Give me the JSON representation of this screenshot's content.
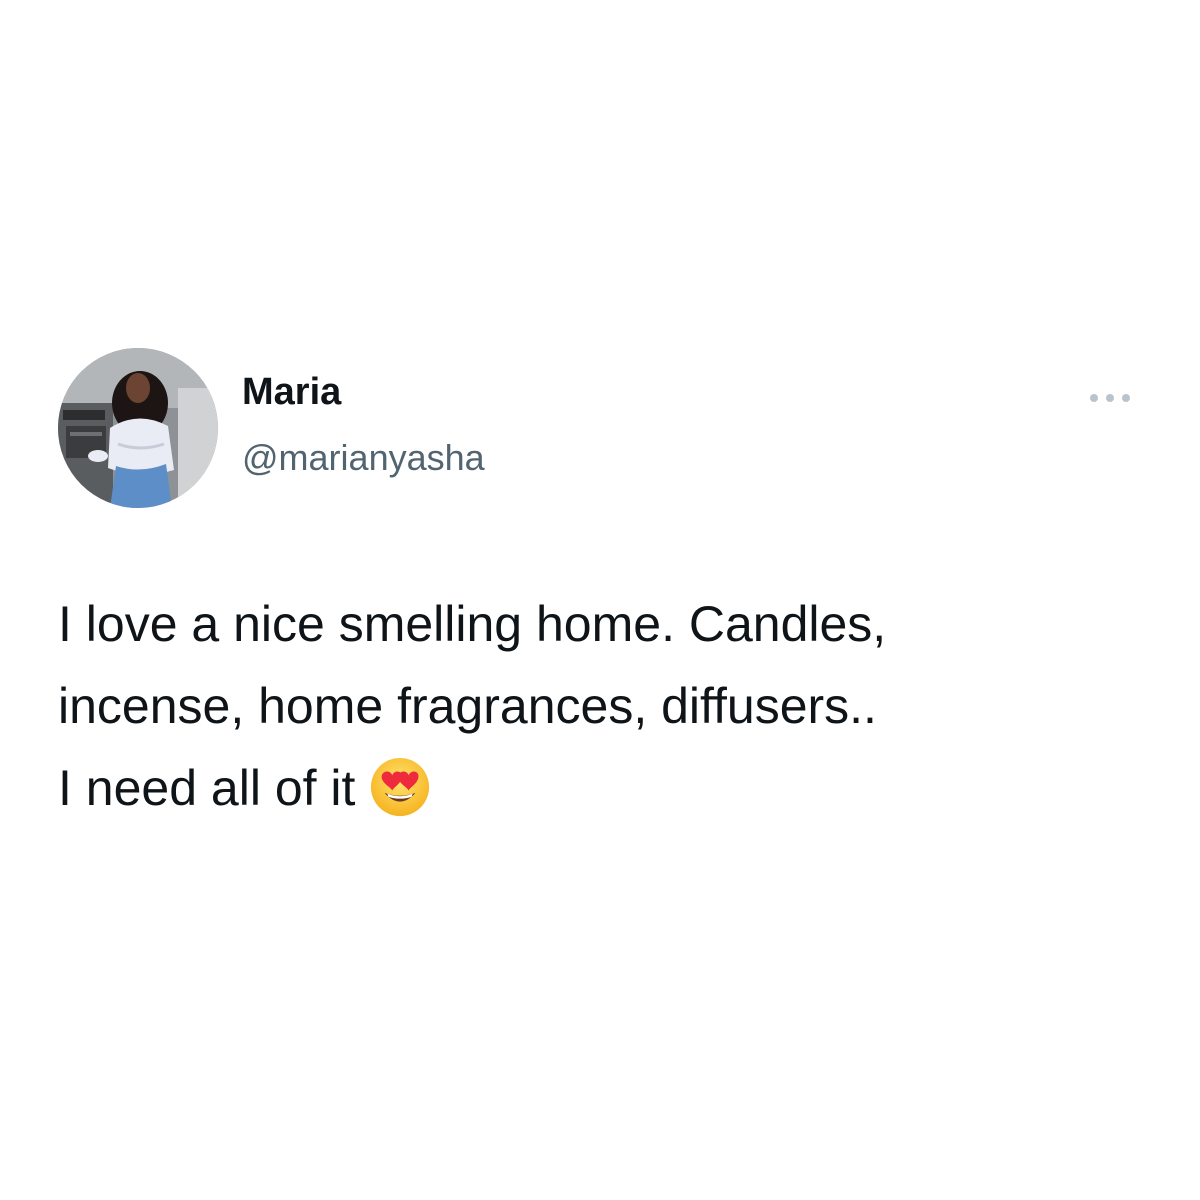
{
  "tweet": {
    "author": {
      "display_name": "Maria",
      "handle": "@marianyasha",
      "avatar": "profile-photo"
    },
    "more_icon": "more-options-icon",
    "text_lines": [
      "I love a nice smelling home. Candles,",
      "incense, home fragrances, diffusers..",
      "I need all of it"
    ],
    "emoji": "heart-eyes-emoji"
  },
  "colors": {
    "background": "#ffffff",
    "text_primary": "#0f1419",
    "text_secondary": "#536471",
    "icon_muted": "#b9c3cb"
  }
}
